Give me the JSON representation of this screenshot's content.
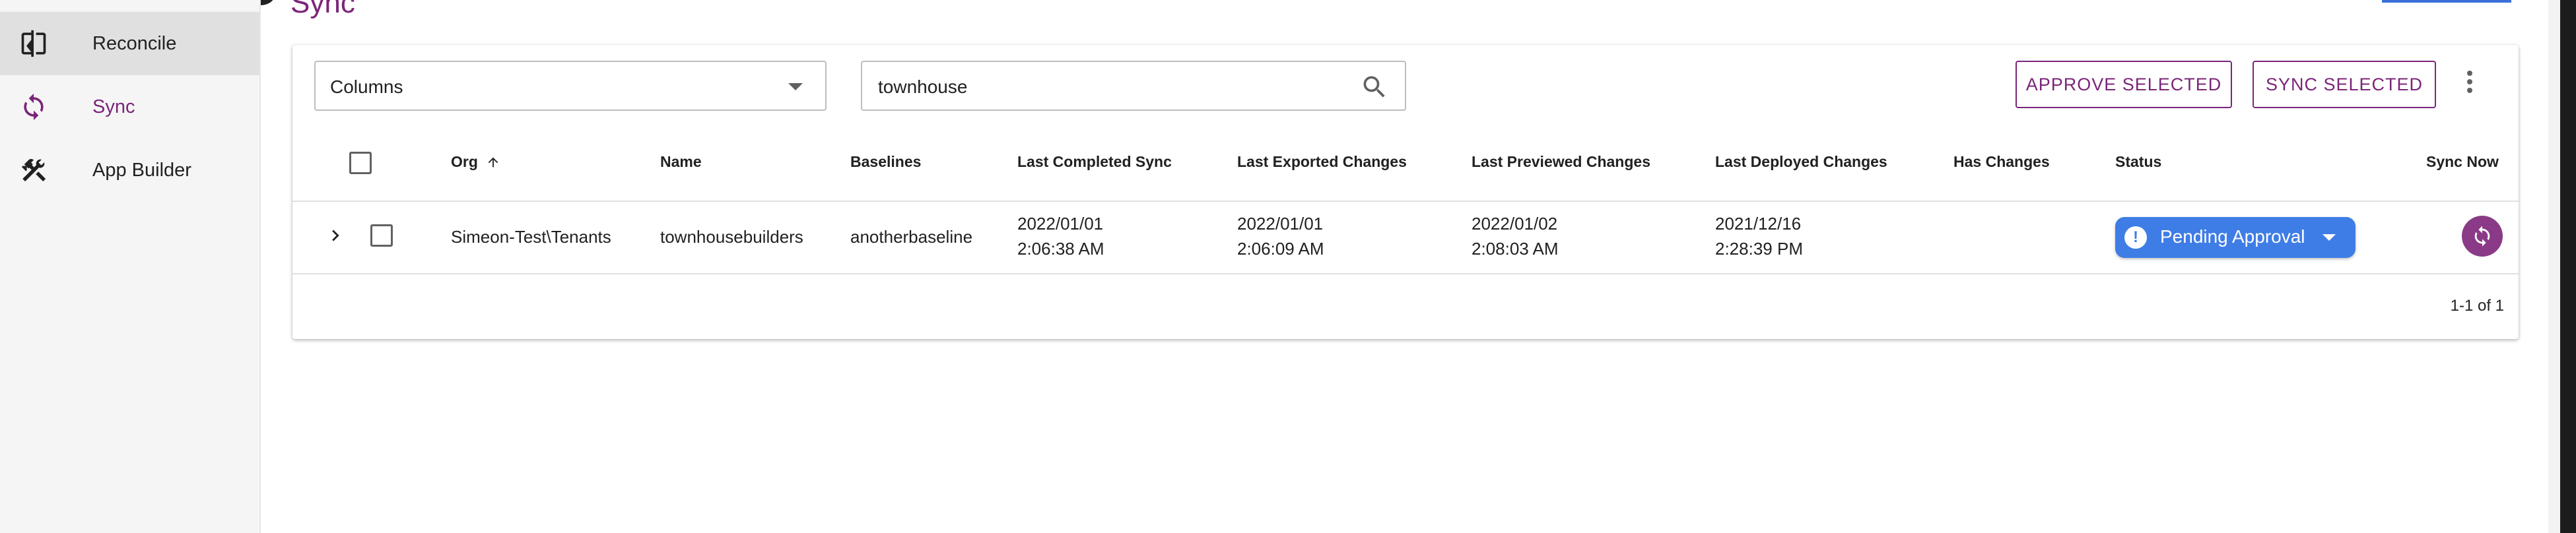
{
  "header": {
    "title": "Sync"
  },
  "sidebar": {
    "items": [
      {
        "label": "Reconcile",
        "icon": "reconcile-icon"
      },
      {
        "label": "Sync",
        "icon": "sync-icon"
      },
      {
        "label": "App Builder",
        "icon": "tools-icon"
      }
    ]
  },
  "toolbar": {
    "columns_label": "Columns",
    "search_value": "townhouse",
    "approve_label": "APPROVE SELECTED",
    "sync_label": "SYNC SELECTED"
  },
  "table": {
    "headers": {
      "org": "Org",
      "name": "Name",
      "baselines": "Baselines",
      "last_completed": "Last Completed Sync",
      "last_exported": "Last Exported Changes",
      "last_previewed": "Last Previewed Changes",
      "last_deployed": "Last Deployed Changes",
      "has_changes": "Has Changes",
      "status": "Status",
      "sync_now": "Sync Now"
    },
    "rows": [
      {
        "org": "Simeon-Test\\Tenants",
        "name": "townhousebuilders",
        "baselines": "anotherbaseline",
        "last_completed_date": "2022/01/01",
        "last_completed_time": "2:06:38 AM",
        "last_exported_date": "2022/01/01",
        "last_exported_time": "2:06:09 AM",
        "last_previewed_date": "2022/01/02",
        "last_previewed_time": "2:08:03 AM",
        "last_deployed_date": "2021/12/16",
        "last_deployed_time": "2:28:39 PM",
        "status": "Pending Approval"
      }
    ],
    "pagination": "1-1 of 1"
  },
  "colors": {
    "accent": "#7b2579",
    "status_blue": "#3f7de6",
    "has_changes_green": "#3f9142"
  }
}
